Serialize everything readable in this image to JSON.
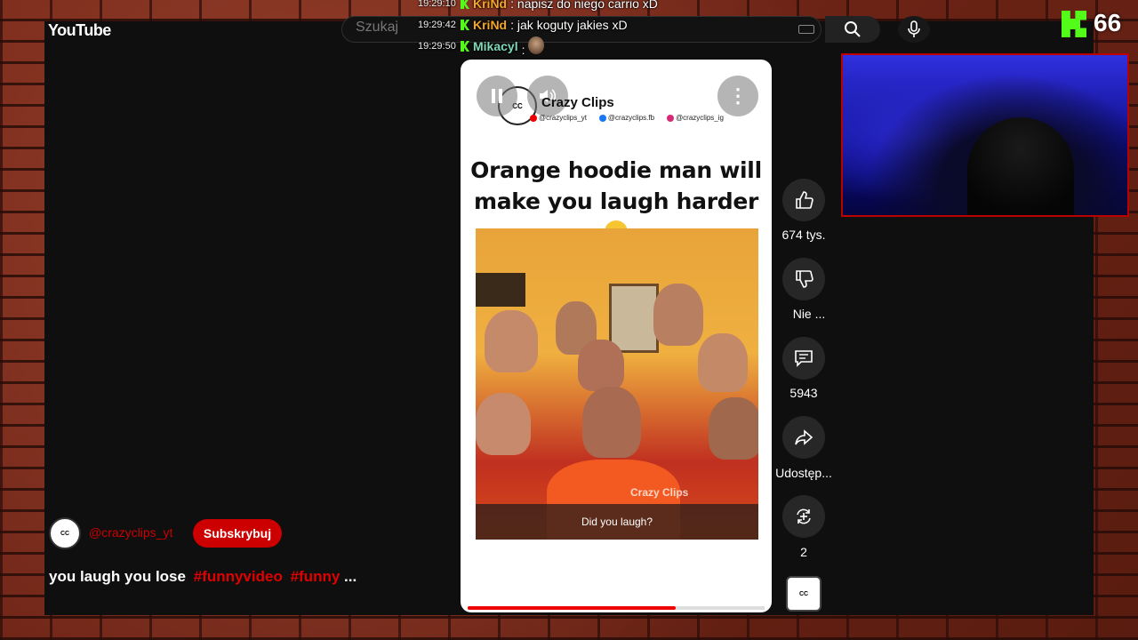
{
  "app": {
    "logo_text": "YouTube",
    "search_placeholder": "Szukaj"
  },
  "chat": [
    {
      "time": "19:29:10",
      "user": "KriNd",
      "user_color": "#f5a623",
      "message": "napisz do niego carrio xD"
    },
    {
      "time": "19:29:42",
      "user": "KriNd",
      "user_color": "#f5a623",
      "message": "jak koguty jakies xD"
    },
    {
      "time": "19:29:50",
      "user": "Mikacyl",
      "user_color": "#7fd8b8",
      "message": ""
    }
  ],
  "stream": {
    "platform_icon": "kick-logo-icon",
    "viewer_count": "66"
  },
  "short": {
    "brand_name": "Crazy Clips",
    "socials": [
      {
        "icon": "youtube-icon",
        "color": "#e00",
        "handle": "@crazyclips_yt"
      },
      {
        "icon": "facebook-icon",
        "color": "#1877f2",
        "handle": "@crazyclips.fb"
      },
      {
        "icon": "instagram-icon",
        "color": "#d62976",
        "handle": "@crazyclips_ig"
      }
    ],
    "title": "Orange hoodie man will make you laugh harder",
    "title_emoji": "laughing-tears-emoji",
    "watermark": "Crazy Clips",
    "caption": "Did you laugh?",
    "progress": 0.7
  },
  "actions": {
    "like_count": "674 tys.",
    "dislike_label": "Nie ...",
    "comment_count": "5943",
    "share_label": "Udostęp...",
    "remix_count": "2"
  },
  "channel": {
    "handle": "@crazyclips_yt",
    "subscribe_label": "Subskrybuj",
    "description": "you laugh you lose",
    "tags": [
      "#funnyvideo",
      "#funny"
    ],
    "more": "..."
  },
  "colors": {
    "accent": "#cc0000",
    "kick_green": "#53fc18",
    "webcam_border": "#bb0000"
  }
}
